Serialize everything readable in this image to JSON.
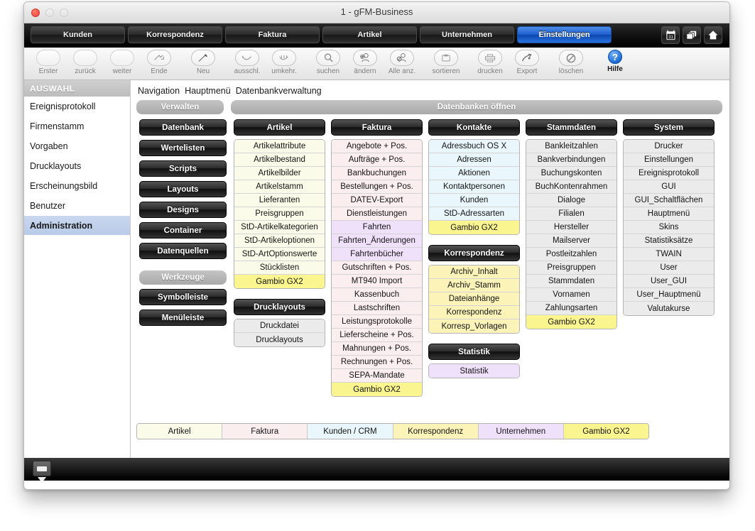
{
  "window": {
    "title": "1 - gFM-Business",
    "traffic_lights": [
      "close",
      "minimize",
      "zoom"
    ]
  },
  "tabbar": {
    "tabs": [
      {
        "label": "Kunden",
        "active": false
      },
      {
        "label": "Korrespondenz",
        "active": false
      },
      {
        "label": "Faktura",
        "active": false
      },
      {
        "label": "Artikel",
        "active": false
      },
      {
        "label": "Unternehmen",
        "active": false
      },
      {
        "label": "Einstellungen",
        "active": true
      }
    ],
    "window_icons": [
      "calendar-31-icon",
      "windows-stack-icon",
      "home-icon"
    ],
    "active_color": "#1f5fd0"
  },
  "toolbar": {
    "items": [
      {
        "label": "Erster",
        "icon": "first-record-icon",
        "style": "plain"
      },
      {
        "label": "zurück",
        "icon": "previous-record-icon",
        "style": "plain"
      },
      {
        "label": "weiter",
        "icon": "next-record-icon",
        "style": "plain"
      },
      {
        "label": "Ende",
        "icon": "last-record-icon",
        "style": "glyph"
      },
      {
        "label": "Neu",
        "icon": "new-record-pencil-icon",
        "style": "glyph",
        "gap": true
      },
      {
        "label": "ausschl.",
        "icon": "omit-record-icon",
        "style": "glyph",
        "gap": true
      },
      {
        "label": "umkehr.",
        "icon": "omit-multiple-icon",
        "style": "glyph"
      },
      {
        "label": "suchen",
        "icon": "search-magnifier-icon",
        "style": "glyph",
        "gap": true
      },
      {
        "label": "ändern",
        "icon": "modify-record-icon",
        "style": "glyph"
      },
      {
        "label": "Alle anz.",
        "icon": "show-all-records-icon",
        "style": "glyph"
      },
      {
        "label": "sortieren",
        "icon": "sort-icon",
        "style": "glyph",
        "gap": true
      },
      {
        "label": "drucken",
        "icon": "print-icon",
        "style": "glyph",
        "gap": true
      },
      {
        "label": "Export",
        "icon": "export-icon",
        "style": "glyph"
      },
      {
        "label": "löschen",
        "icon": "delete-forbidden-icon",
        "style": "glyph",
        "gap": true
      },
      {
        "label": "Hilfe",
        "icon": "help-question-icon",
        "style": "blue",
        "gap": true
      }
    ]
  },
  "sidebar": {
    "header": "AUSWAHL",
    "items": [
      {
        "label": "Ereignisprotokoll",
        "selected": false
      },
      {
        "label": "Firmenstamm",
        "selected": false
      },
      {
        "label": "Vorgaben",
        "selected": false
      },
      {
        "label": "Drucklayouts",
        "selected": false
      },
      {
        "label": "Erscheinungsbild",
        "selected": false
      },
      {
        "label": "Benutzer",
        "selected": false
      },
      {
        "label": "Administration",
        "selected": true
      }
    ]
  },
  "breadcrumb": [
    "Navigation",
    "Hauptmenü",
    "Datenbankverwaltung"
  ],
  "headers": {
    "verwalten": "Verwalten",
    "datenbanken_oeffnen": "Datenbanken öffnen",
    "werkzeuge": "Werkzeuge"
  },
  "left_buttons": {
    "verwalten": [
      "Datenbank",
      "Wertelisten",
      "Scripts",
      "Layouts",
      "Designs",
      "Container",
      "Datenquellen"
    ],
    "werkzeuge": [
      "Symbolleiste",
      "Menüleiste"
    ]
  },
  "columns": [
    {
      "groups": [
        {
          "title": "Artikel",
          "items": [
            {
              "label": "Artikelattribute",
              "color": "c-artikel"
            },
            {
              "label": "Artikelbestand",
              "color": "c-artikel"
            },
            {
              "label": "Artikelbilder",
              "color": "c-artikel"
            },
            {
              "label": "Artikelstamm",
              "color": "c-artikel"
            },
            {
              "label": "Lieferanten",
              "color": "c-artikel"
            },
            {
              "label": "Preisgruppen",
              "color": "c-artikel"
            },
            {
              "label": "StD-Artikelkategorien",
              "color": "c-artikel"
            },
            {
              "label": "StD-Artikeloptionen",
              "color": "c-artikel"
            },
            {
              "label": "StD-ArtOptionswerte",
              "color": "c-artikel"
            },
            {
              "label": "Stücklisten",
              "color": "c-artikel"
            },
            {
              "label": "Gambio GX2",
              "color": "c-gambio"
            }
          ]
        },
        {
          "title": "Drucklayouts",
          "items": [
            {
              "label": "Druckdatei",
              "color": "c-grey"
            },
            {
              "label": "Drucklayouts",
              "color": "c-grey"
            }
          ]
        }
      ]
    },
    {
      "groups": [
        {
          "title": "Faktura",
          "items": [
            {
              "label": "Angebote + Pos.",
              "color": "c-faktura"
            },
            {
              "label": "Aufträge + Pos.",
              "color": "c-faktura"
            },
            {
              "label": "Bankbuchungen",
              "color": "c-faktura"
            },
            {
              "label": "Bestellungen + Pos.",
              "color": "c-faktura"
            },
            {
              "label": "DATEV-Export",
              "color": "c-faktura"
            },
            {
              "label": "Dienstleistungen",
              "color": "c-faktura"
            },
            {
              "label": "Fahrten",
              "color": "c-untern"
            },
            {
              "label": "Fahrten_Änderungen",
              "color": "c-untern"
            },
            {
              "label": "Fahrtenbücher",
              "color": "c-untern"
            },
            {
              "label": "Gutschriften + Pos.",
              "color": "c-faktura"
            },
            {
              "label": "MT940 Import",
              "color": "c-faktura"
            },
            {
              "label": "Kassenbuch",
              "color": "c-faktura"
            },
            {
              "label": "Lastschriften",
              "color": "c-faktura"
            },
            {
              "label": "Leistungsprotokolle",
              "color": "c-faktura"
            },
            {
              "label": "Lieferscheine + Pos.",
              "color": "c-faktura"
            },
            {
              "label": "Mahnungen + Pos.",
              "color": "c-faktura"
            },
            {
              "label": "Rechnungen + Pos.",
              "color": "c-faktura"
            },
            {
              "label": "SEPA-Mandate",
              "color": "c-faktura"
            },
            {
              "label": "Gambio GX2",
              "color": "c-gambio"
            }
          ]
        }
      ]
    },
    {
      "groups": [
        {
          "title": "Kontakte",
          "items": [
            {
              "label": "Adressbuch OS X",
              "color": "c-kunden"
            },
            {
              "label": "Adressen",
              "color": "c-kunden"
            },
            {
              "label": "Aktionen",
              "color": "c-kunden"
            },
            {
              "label": "Kontaktpersonen",
              "color": "c-kunden"
            },
            {
              "label": "Kunden",
              "color": "c-kunden"
            },
            {
              "label": "StD-Adressarten",
              "color": "c-kunden"
            },
            {
              "label": "Gambio GX2",
              "color": "c-gambio"
            }
          ]
        },
        {
          "title": "Korrespondenz",
          "items": [
            {
              "label": "Archiv_Inhalt",
              "color": "c-korresp"
            },
            {
              "label": "Archiv_Stamm",
              "color": "c-korresp"
            },
            {
              "label": "Dateianhänge",
              "color": "c-korresp"
            },
            {
              "label": "Korrespondenz",
              "color": "c-korresp"
            },
            {
              "label": "Korresp_Vorlagen",
              "color": "c-korresp"
            }
          ]
        },
        {
          "title": "Statistik",
          "items": [
            {
              "label": "Statistik",
              "color": "c-untern"
            }
          ]
        }
      ]
    },
    {
      "groups": [
        {
          "title": "Stammdaten",
          "items": [
            {
              "label": "Bankleitzahlen",
              "color": "c-grey"
            },
            {
              "label": "Bankverbindungen",
              "color": "c-grey"
            },
            {
              "label": "Buchungskonten",
              "color": "c-grey"
            },
            {
              "label": "BuchKontenrahmen",
              "color": "c-grey"
            },
            {
              "label": "Dialoge",
              "color": "c-grey"
            },
            {
              "label": "Filialen",
              "color": "c-grey"
            },
            {
              "label": "Hersteller",
              "color": "c-grey"
            },
            {
              "label": "Mailserver",
              "color": "c-grey"
            },
            {
              "label": "Postleitzahlen",
              "color": "c-grey"
            },
            {
              "label": "Preisgruppen",
              "color": "c-grey"
            },
            {
              "label": "Stammdaten",
              "color": "c-grey"
            },
            {
              "label": "Vornamen",
              "color": "c-grey"
            },
            {
              "label": "Zahlungsarten",
              "color": "c-grey"
            },
            {
              "label": "Gambio GX2",
              "color": "c-gambio"
            }
          ]
        }
      ]
    },
    {
      "groups": [
        {
          "title": "System",
          "items": [
            {
              "label": "Drucker",
              "color": "c-grey"
            },
            {
              "label": "Einstellungen",
              "color": "c-grey"
            },
            {
              "label": "Ereignisprotokoll",
              "color": "c-grey"
            },
            {
              "label": "GUI",
              "color": "c-grey"
            },
            {
              "label": "GUI_Schaltflächen",
              "color": "c-grey"
            },
            {
              "label": "Hauptmenü",
              "color": "c-grey"
            },
            {
              "label": "Skins",
              "color": "c-grey"
            },
            {
              "label": "Statistiksätze",
              "color": "c-grey"
            },
            {
              "label": "TWAIN",
              "color": "c-grey"
            },
            {
              "label": "User",
              "color": "c-grey"
            },
            {
              "label": "User_GUI",
              "color": "c-grey"
            },
            {
              "label": "User_Hauptmenü",
              "color": "c-grey"
            },
            {
              "label": "Valutakurse",
              "color": "c-grey"
            }
          ]
        }
      ]
    }
  ],
  "legend": [
    {
      "label": "Artikel",
      "color": "c-artikel"
    },
    {
      "label": "Faktura",
      "color": "c-faktura"
    },
    {
      "label": "Kunden / CRM",
      "color": "c-kunden"
    },
    {
      "label": "Korrespondenz",
      "color": "c-korresp"
    },
    {
      "label": "Unternehmen",
      "color": "c-untern"
    },
    {
      "label": "Gambio GX2",
      "color": "c-gambio"
    }
  ],
  "footer": {
    "status_icon": "layout-mode-popup-icon"
  }
}
